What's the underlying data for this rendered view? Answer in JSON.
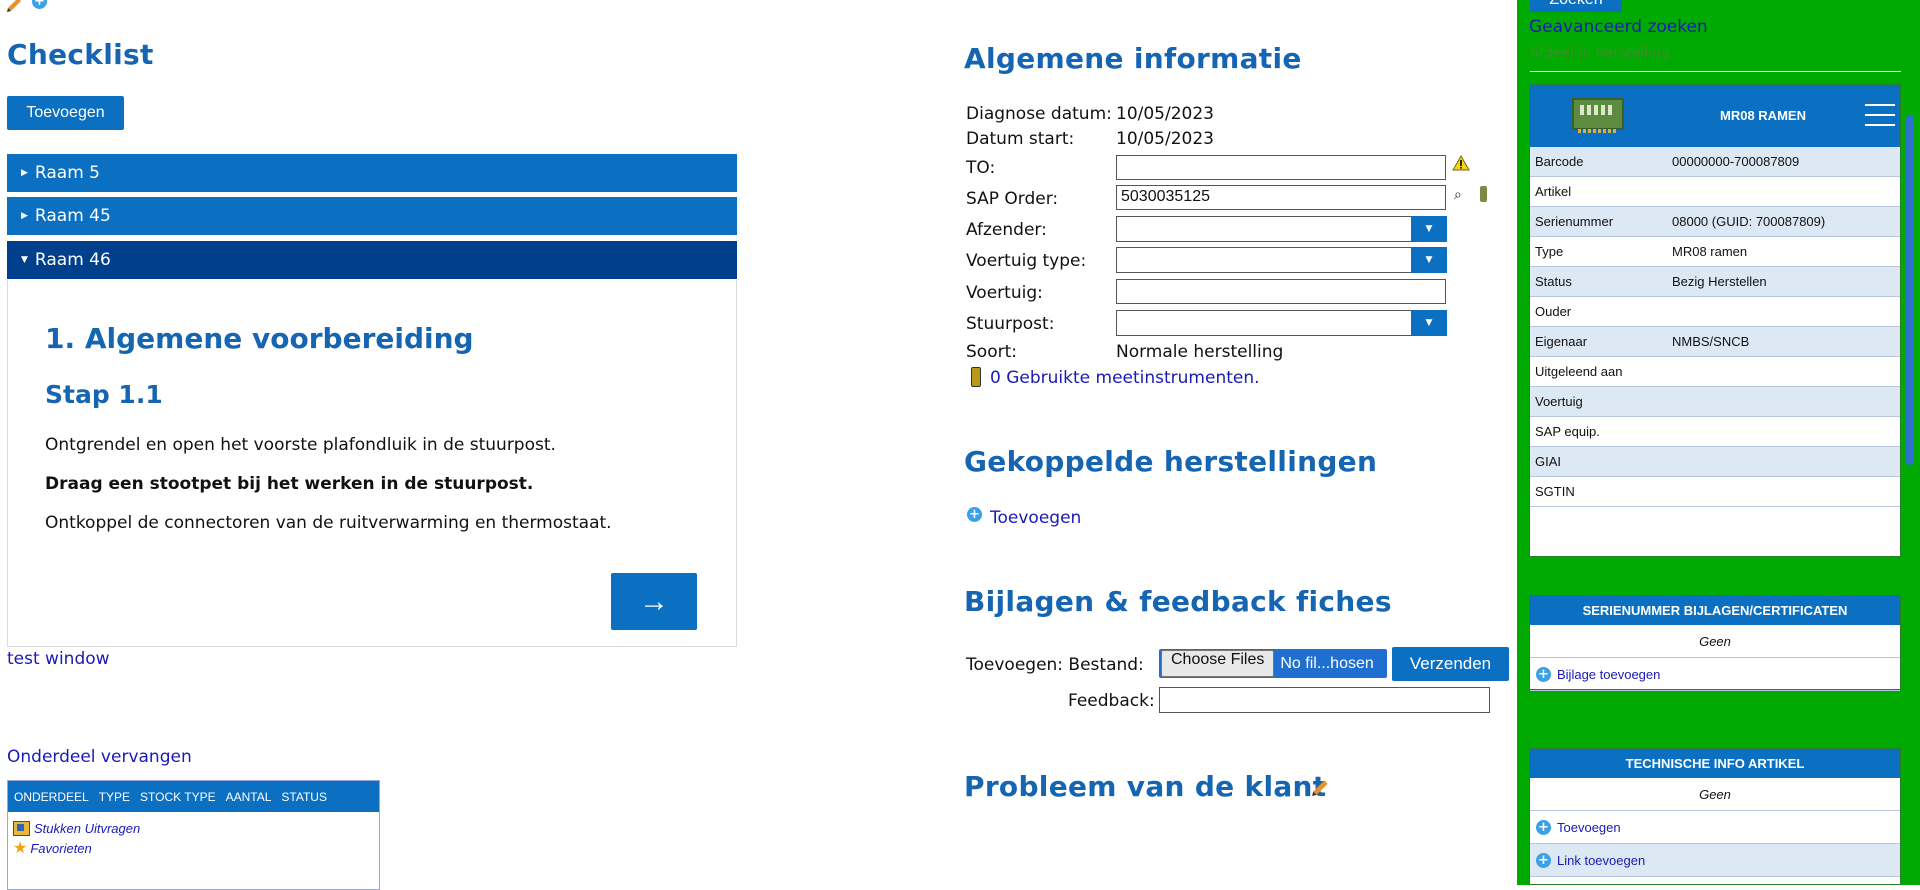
{
  "checklist": {
    "title": "Checklist",
    "add_label": "Toevoegen",
    "accordion": [
      {
        "label": "Raam 5",
        "open": false
      },
      {
        "label": "Raam 45",
        "open": false
      },
      {
        "label": "Raam 46",
        "open": true
      }
    ],
    "step": {
      "section_title": "1. Algemene voorbereiding",
      "step_title": "Stap 1.1",
      "text1": "Ontgrendel en open het voorste plafondluik in de stuurpost.",
      "text2": "Draag een stootpet bij het werken in de stuurpost.",
      "text3": "Ontkoppel de connectoren van de ruitverwarming en thermostaat.",
      "next_label": "→"
    },
    "test_window_link": "test window",
    "onderdeel_link": "Onderdeel vervangen",
    "parts_table": {
      "columns": [
        "ONDERDEEL",
        "TYPE",
        "STOCK TYPE",
        "AANTAL",
        "STATUS"
      ],
      "links": [
        "Stukken Uitvragen",
        "Favorieten"
      ]
    }
  },
  "general": {
    "title": "Algemene informatie",
    "labels": {
      "diag": "Diagnose datum:",
      "start": "Datum start:",
      "to": "TO:",
      "sap": "SAP Order:",
      "afz": "Afzender:",
      "vtype": "Voertuig type:",
      "voert": "Voertuig:",
      "stuur": "Stuurpost:",
      "soort": "Soort:"
    },
    "values": {
      "diag": "10/05/2023",
      "start": "10/05/2023",
      "to": "",
      "sap": "5030035125",
      "afz": "",
      "vtype": "",
      "voert": "",
      "stuur": "",
      "soort": "Normale herstelling"
    },
    "meet_link": "0 Gebruikte meetinstrumenten."
  },
  "gekoppelde": {
    "title": "Gekoppelde herstellingen",
    "add_label": "Toevoegen"
  },
  "bijlagen": {
    "title": "Bijlagen & feedback fiches",
    "toevoegen_label": "Toevoegen: Bestand:",
    "choose_label": "Choose Files",
    "no_file_label": "No fil...hosen",
    "send_label": "Verzenden",
    "feedback_label": "Feedback:",
    "feedback_value": ""
  },
  "probleem": {
    "title": "Probleem van de klant"
  },
  "sidebar": {
    "search_button": "Zoeken",
    "advanced_search": "Geavanceerd zoeken",
    "afdeel_link": "Afdeel in herstelling",
    "info_card": {
      "title": "MR08 RAMEN",
      "rows": [
        {
          "key": "Barcode",
          "value": "00000000-700087809"
        },
        {
          "key": "Artikel",
          "value": ""
        },
        {
          "key": "Serienummer",
          "value": "08000 (GUID: 700087809)"
        },
        {
          "key": "Type",
          "value": "MR08 ramen"
        },
        {
          "key": "Status",
          "value": "Bezig Herstellen"
        },
        {
          "key": "Ouder",
          "value": ""
        },
        {
          "key": "Eigenaar",
          "value": "NMBS/SNCB"
        },
        {
          "key": "Uitgeleend aan",
          "value": ""
        },
        {
          "key": "Voertuig",
          "value": ""
        },
        {
          "key": "SAP equip.",
          "value": ""
        },
        {
          "key": "GIAI",
          "value": ""
        },
        {
          "key": "SGTIN",
          "value": ""
        }
      ]
    },
    "serie_card": {
      "title": "SERIENUMMER BIJLAGEN/CERTIFICATEN",
      "empty": "Geen",
      "link": "Bijlage toevoegen"
    },
    "tech_card": {
      "title": "TECHNISCHE INFO ARTIKEL",
      "empty": "Geen",
      "link1": "Toevoegen",
      "link2": "Link toevoegen"
    }
  },
  "colors": {
    "accent_blue": "#0b6fc2",
    "heading_blue": "#1565b3",
    "sidebar_green": "#00aa00",
    "accordion_open": "#003f8c"
  }
}
